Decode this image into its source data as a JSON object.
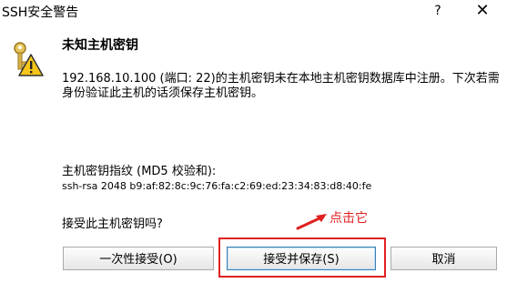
{
  "window": {
    "title": "SSH安全警告",
    "help_glyph": "?",
    "close_glyph": "✕"
  },
  "dialog": {
    "icon": "key-warning-icon",
    "heading": "未知主机密钥",
    "description": "192.168.10.100 (端口: 22)的主机密钥未在本地主机密钥数据库中注册。下次若需身份验证此主机的话须保存主机密钥。",
    "fingerprint_label": "主机密钥指纹 (MD5 校验和):",
    "fingerprint_value": "ssh-rsa 2048 b9:af:82:8c:9c:76:fa:c2:69:ed:23:34:83:d8:40:fe",
    "question": "接受此主机密钥吗?"
  },
  "buttons": {
    "accept_once": "一次性接受(O)",
    "accept_save": "接受并保存(S)",
    "cancel": "取消"
  },
  "annotation": {
    "label": "点击它",
    "color": "#e02020"
  }
}
